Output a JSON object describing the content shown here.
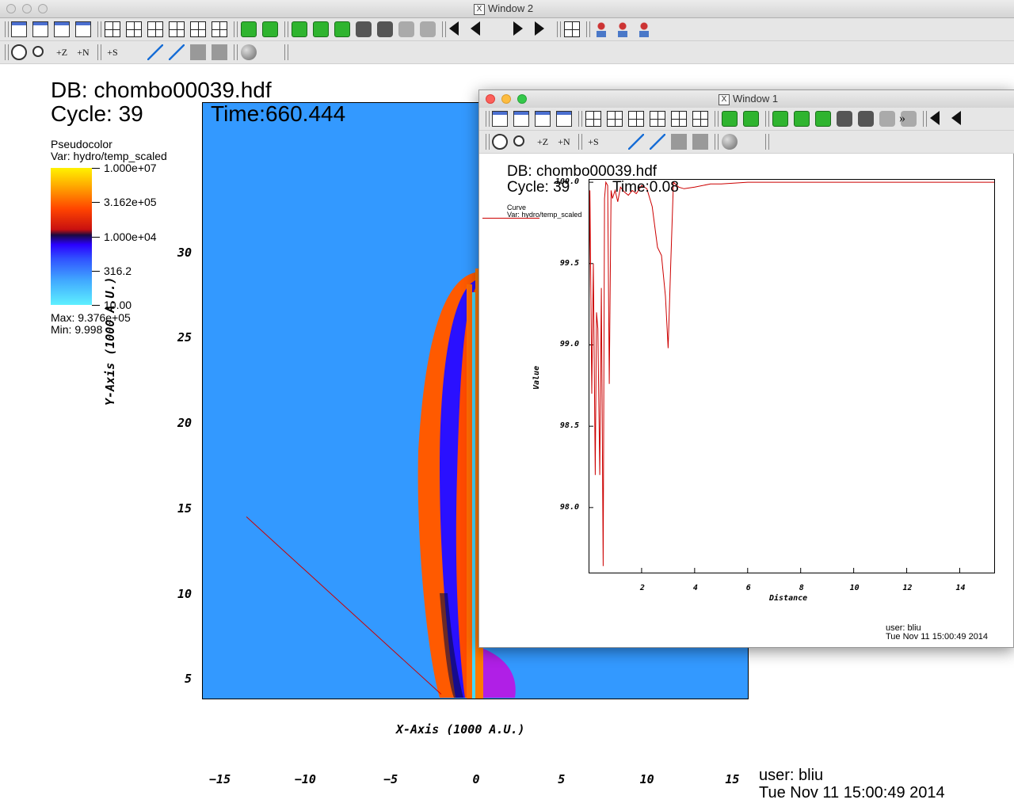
{
  "window2": {
    "title": "Window 2",
    "db_label": "DB: chombo00039.hdf",
    "cycle_label": "Cycle: 39",
    "time_label": "Time:660.444",
    "legend": {
      "plot_type": "Pseudocolor",
      "var": "Var: hydro/temp_scaled",
      "ticks": [
        "1.000e+07",
        "3.162e+05",
        "1.000e+04",
        "316.2",
        "10.00"
      ],
      "max": "Max:  9.376e+05",
      "min": "Min:  9.998"
    },
    "xaxis_label": "X-Axis (1000 A.U.)",
    "yaxis_label": "Y-Axis (1000 A.U.)",
    "xticks": [
      "−15",
      "−10",
      "−5",
      "0",
      "5",
      "10",
      "15"
    ],
    "yticks": [
      "30",
      "25",
      "20",
      "15",
      "10",
      "5"
    ],
    "user": "user: bliu",
    "date": "Tue Nov 11 15:00:49 2014",
    "colors": {
      "background_field": "#3399ff",
      "lineout": "#cc0000"
    }
  },
  "window1": {
    "title": "Window 1",
    "db_label": "DB: chombo00039.hdf",
    "cycle_label": "Cycle: 39",
    "time_label": "Time:0.08",
    "legend_type": "Curve",
    "legend_var": "Var: hydro/temp_scaled",
    "overflow_label": "»",
    "xaxis_label": "Distance",
    "yaxis_label": "Value",
    "user": "user: bliu",
    "date": "Tue Nov 11 15:00:49 2014"
  },
  "toolbar_icons": {
    "row1": [
      "new-window-icon",
      "clone-window-icon",
      "copy-window-icon",
      "delete-window-icon",
      "layout-1x1-icon",
      "layout-1x2-icon",
      "layout-2x2-icon",
      "layout-2x3-icon",
      "layout-2x4-icon",
      "layout-3x3-icon",
      "lock-icon",
      "invert-icon",
      "view-3d-icon",
      "save-image-icon",
      "print-image-icon",
      "camera-icon",
      "camera2-icon",
      "camera3-icon",
      "camera4-icon",
      "animation-first-icon",
      "animation-back-icon",
      "animation-stop-icon",
      "animation-play-icon",
      "animation-next-icon",
      "spreadsheet-icon",
      "pick-icon",
      "pick2-icon",
      "lineout-icon"
    ],
    "row2": [
      "navigate-icon",
      "zoom-icon",
      "zone-pick-z-icon",
      "node-pick-n-icon",
      "spreadsheet-pick-s-icon",
      "lineout-mode-icon",
      "pick-pointer-icon",
      "line-tool-icon",
      "plane-tool-icon",
      "box-tool-icon",
      "sphere-tool-icon",
      "point-tool-icon"
    ],
    "pick_labels": {
      "z": "+Z",
      "n": "+N",
      "s": "+S"
    }
  },
  "chart_data": [
    {
      "type": "heatmap",
      "title": "",
      "variable": "hydro/temp_scaled",
      "colormap": "hot-cold log scale",
      "xlabel": "X-Axis (1000 A.U.)",
      "ylabel": "Y-Axis (1000 A.U.)",
      "xlim": [
        -16,
        16
      ],
      "ylim": [
        0,
        35
      ],
      "xticks": [
        -15,
        -10,
        -5,
        0,
        5,
        10,
        15
      ],
      "yticks": [
        5,
        10,
        15,
        20,
        25,
        30
      ],
      "color_range": [
        10.0,
        10000000.0
      ],
      "data_max": 937600,
      "data_min": 9.998,
      "lineout": {
        "x": [
          -13.4,
          -2.0
        ],
        "y": [
          10.7,
          0.3
        ]
      }
    },
    {
      "type": "line",
      "title": "",
      "xlabel": "Distance",
      "ylabel": "Value",
      "xlim": [
        0,
        15.3
      ],
      "ylim": [
        97.6,
        100.02
      ],
      "xticks": [
        2,
        4,
        6,
        8,
        10,
        12,
        14
      ],
      "yticks": [
        98.0,
        98.5,
        99.0,
        99.5,
        100.0
      ],
      "series": [
        {
          "x": [
            0.0,
            0.05,
            0.12,
            0.18,
            0.25,
            0.3,
            0.35,
            0.42,
            0.48,
            0.55,
            0.6,
            0.65,
            0.72,
            0.78,
            0.85,
            0.9,
            1.0,
            1.1,
            1.2,
            1.35,
            1.5,
            1.65,
            1.8,
            2.0,
            2.2,
            2.4,
            2.6,
            2.75,
            2.9,
            3.0,
            3.1,
            3.2,
            3.4,
            3.6,
            4.0,
            4.6,
            5.0,
            6.0,
            8.0,
            10.0,
            12.0,
            14.0,
            15.3
          ],
          "y": [
            99.0,
            99.95,
            98.7,
            99.5,
            98.2,
            99.2,
            99.1,
            98.2,
            99.35,
            97.64,
            99.9,
            100.0,
            99.98,
            98.76,
            99.95,
            99.9,
            99.95,
            99.88,
            99.97,
            99.94,
            99.92,
            99.95,
            99.93,
            99.98,
            99.96,
            99.85,
            99.6,
            99.55,
            99.3,
            98.98,
            99.5,
            100.0,
            99.97,
            99.96,
            99.97,
            99.99,
            99.99,
            100.0,
            100.0,
            100.0,
            100.0,
            100.0,
            100.0
          ]
        }
      ]
    }
  ]
}
